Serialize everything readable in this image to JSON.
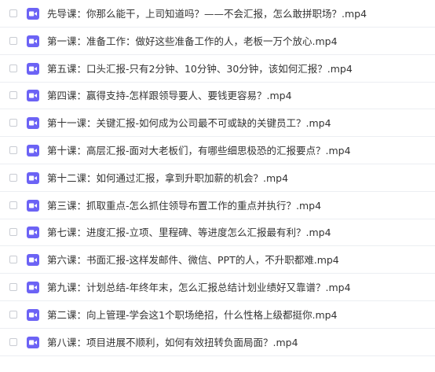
{
  "colors": {
    "video_icon": "#6c63f5",
    "text": "#333333",
    "row_divider": "#eceef2"
  },
  "icon_name": "video-file-icon",
  "files": [
    {
      "name": "先导课：你那么能干，上司知道吗？——不会汇报，怎么敢拼职场？.mp4"
    },
    {
      "name": "第一课：准备工作：做好这些准备工作的人，老板一万个放心.mp4"
    },
    {
      "name": "第五课：口头汇报-只有2分钟、10分钟、30分钟，该如何汇报？.mp4"
    },
    {
      "name": "第四课：赢得支持-怎样跟领导要人、要钱更容易？.mp4"
    },
    {
      "name": "第十一课：关键汇报-如何成为公司最不可或缺的关键员工？.mp4"
    },
    {
      "name": "第十课：高层汇报-面对大老板们，有哪些细思极恐的汇报要点？.mp4"
    },
    {
      "name": "第十二课：如何通过汇报，拿到升职加薪的机会？.mp4"
    },
    {
      "name": "第三课：抓取重点-怎么抓住领导布置工作的重点并执行？.mp4"
    },
    {
      "name": "第七课：进度汇报-立项、里程碑、等进度怎么汇报最有利？.mp4"
    },
    {
      "name": "第六课：书面汇报-这样发邮件、微信、PPT的人，不升职都难.mp4"
    },
    {
      "name": "第九课：计划总结-年终年末，怎么汇报总结计划业绩好又靠谱？.mp4"
    },
    {
      "name": "第二课：向上管理-学会这1个职场绝招，什么性格上级都挺你.mp4"
    },
    {
      "name": "第八课：项目进展不顺利，如何有效扭转负面局面？.mp4"
    }
  ]
}
